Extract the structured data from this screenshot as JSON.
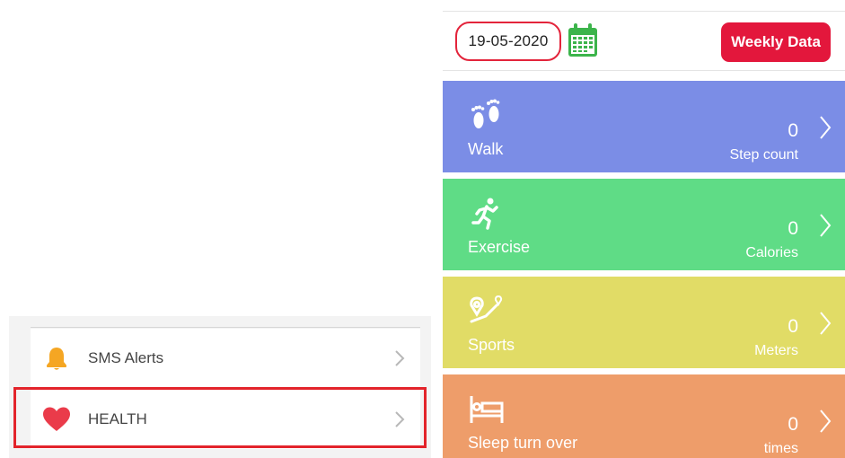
{
  "left_panel": {
    "items": [
      {
        "label": "SMS Alerts",
        "icon": "bell-icon",
        "icon_color": "#f5a623"
      },
      {
        "label": "HEALTH",
        "icon": "heart-icon",
        "icon_color": "#ea3b4a",
        "highlighted": true
      }
    ]
  },
  "right_panel": {
    "date": "19-05-2020",
    "weekly_button": "Weekly Data",
    "accent_color": "#e3173c",
    "cards": [
      {
        "title": "Walk",
        "value": "0",
        "unit": "Step count",
        "color": "#7b8de6",
        "icon": "footprints-icon"
      },
      {
        "title": "Exercise",
        "value": "0",
        "unit": "Calories",
        "color": "#5fdc86",
        "icon": "running-person-icon"
      },
      {
        "title": "Sports",
        "value": "0",
        "unit": "Meters",
        "color": "#e1dc66",
        "icon": "route-pin-icon"
      },
      {
        "title": "Sleep turn over",
        "value": "0",
        "unit": "times",
        "color": "#ee9d6a",
        "icon": "bed-icon"
      }
    ]
  }
}
